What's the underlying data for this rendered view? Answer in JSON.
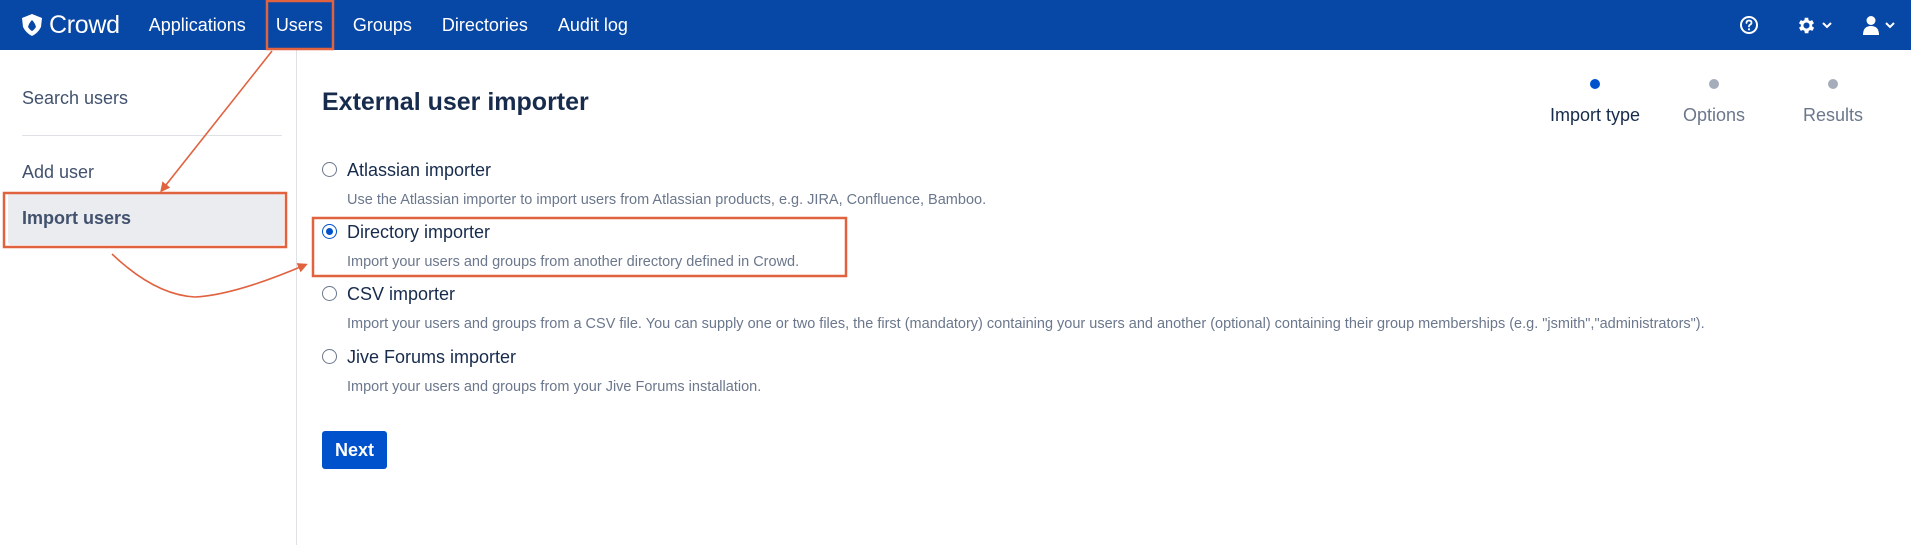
{
  "app": {
    "name": "Crowd",
    "nav": [
      "Applications",
      "Users",
      "Groups",
      "Directories",
      "Audit log"
    ]
  },
  "sidebar": {
    "items": [
      "Search users",
      "Add user",
      "Import users"
    ],
    "active": "Import users"
  },
  "page": {
    "title": "External user importer",
    "steps": [
      "Import type",
      "Options",
      "Results"
    ],
    "active_step": "Import type",
    "options": [
      {
        "label": "Atlassian importer",
        "description": "Use the Atlassian importer to import users from Atlassian products, e.g. JIRA, Confluence, Bamboo.",
        "selected": false
      },
      {
        "label": "Directory importer",
        "description": "Import your users and groups from another directory defined in Crowd.",
        "selected": true
      },
      {
        "label": "CSV importer",
        "description": "Import your users and groups from a CSV file. You can supply one or two files, the first (mandatory) containing your users and another (optional) containing their group memberships (e.g. \"jsmith\",\"administrators\").",
        "selected": false
      },
      {
        "label": "Jive Forums importer",
        "description": "Import your users and groups from your Jive Forums installation.",
        "selected": false
      }
    ],
    "next_label": "Next"
  },
  "icons": {
    "logo": "crowd-logo-icon",
    "help": "help-icon",
    "settings": "gear-icon",
    "user": "user-icon"
  },
  "colors": {
    "nav_bg": "#0747a6",
    "primary": "#0052cc",
    "annotation": "#e0623f"
  }
}
